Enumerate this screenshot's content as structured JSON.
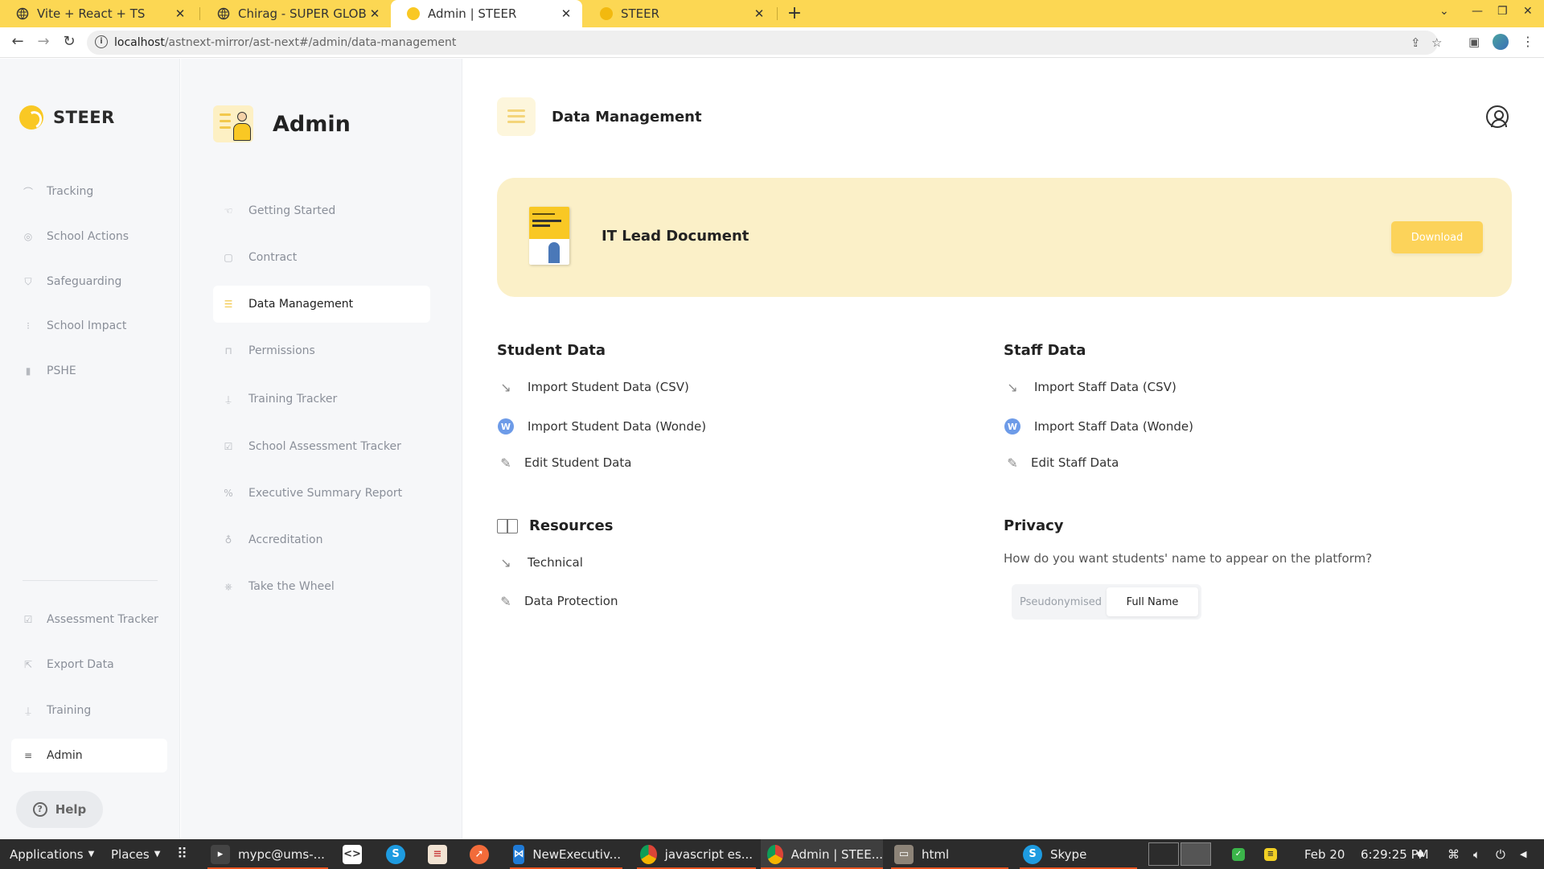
{
  "browser": {
    "tabs": [
      {
        "title": "Vite + React + TS",
        "active": false
      },
      {
        "title": "Chirag - SUPER GLOBAL A",
        "active": false
      },
      {
        "title": "Admin | STEER",
        "active": true
      },
      {
        "title": "STEER",
        "active": false
      }
    ],
    "new_tab": "+",
    "close_glyph": "✕",
    "url_host": "localhost",
    "url_path": "/astnext-mirror/ast-next#/admin/data-management",
    "icons": [
      "back-icon",
      "forward-icon",
      "reload-icon",
      "info-icon",
      "share-icon",
      "star-icon",
      "sidepanel-icon",
      "profile-icon",
      "menu-icon"
    ]
  },
  "sidebar": {
    "logo": "STEER",
    "items": [
      {
        "label": "Tracking",
        "icon": "tracking-icon"
      },
      {
        "label": "School Actions",
        "icon": "target-icon"
      },
      {
        "label": "Safeguarding",
        "icon": "shield-icon"
      },
      {
        "label": "School Impact",
        "icon": "chart-icon"
      },
      {
        "label": "PSHE",
        "icon": "book-icon"
      }
    ],
    "bottom_items": [
      {
        "label": "Assessment Tracker",
        "icon": "assessment-icon"
      },
      {
        "label": "Export Data",
        "icon": "export-icon"
      },
      {
        "label": "Training",
        "icon": "training-icon"
      },
      {
        "label": "Admin",
        "icon": "menu-lines-icon",
        "active": true
      }
    ],
    "help_label": "Help"
  },
  "subnav": {
    "title": "Admin",
    "items": [
      {
        "label": "Getting Started",
        "active": false
      },
      {
        "label": "Contract",
        "active": false
      },
      {
        "label": "Data Management",
        "active": true
      },
      {
        "label": "Permissions",
        "active": false
      },
      {
        "label": "Training Tracker",
        "active": false
      },
      {
        "label": "School Assessment Tracker",
        "active": false
      },
      {
        "label": "Executive Summary Report",
        "active": false
      },
      {
        "label": "Accreditation",
        "active": false
      },
      {
        "label": "Take the Wheel",
        "active": false
      }
    ]
  },
  "main": {
    "title": "Data Management",
    "banner": {
      "title": "IT Lead Document",
      "download_label": "Download"
    },
    "student": {
      "title": "Student Data",
      "actions": [
        "Import Student Data (CSV)",
        "Import Student Data (Wonde)",
        "Edit Student Data"
      ]
    },
    "staff": {
      "title": "Staff Data",
      "actions": [
        "Import Staff Data (CSV)",
        "Import Staff Data (Wonde)",
        "Edit Staff Data"
      ]
    },
    "resources": {
      "title": "Resources",
      "actions": [
        "Technical",
        "Data Protection"
      ]
    },
    "privacy": {
      "title": "Privacy",
      "question": "How do you want students' name to appear on the platform?",
      "options": [
        "Pseudonymised",
        "Full Name"
      ],
      "selected": "Full Name"
    }
  },
  "taskbar": {
    "applications": "Applications",
    "places": "Places",
    "windows": [
      {
        "label": "mypc@ums-..."
      },
      {
        "label": "NewExecutiv..."
      },
      {
        "label": "javascript es..."
      },
      {
        "label": "Admin | STEE..."
      },
      {
        "label": "html"
      },
      {
        "label": "Skype"
      }
    ],
    "date": "Feb 20",
    "time": "6:29:25 PM"
  },
  "colors": {
    "accent": "#f9c824",
    "tabbar": "#fcd753",
    "banner": "#fbf0c8"
  }
}
